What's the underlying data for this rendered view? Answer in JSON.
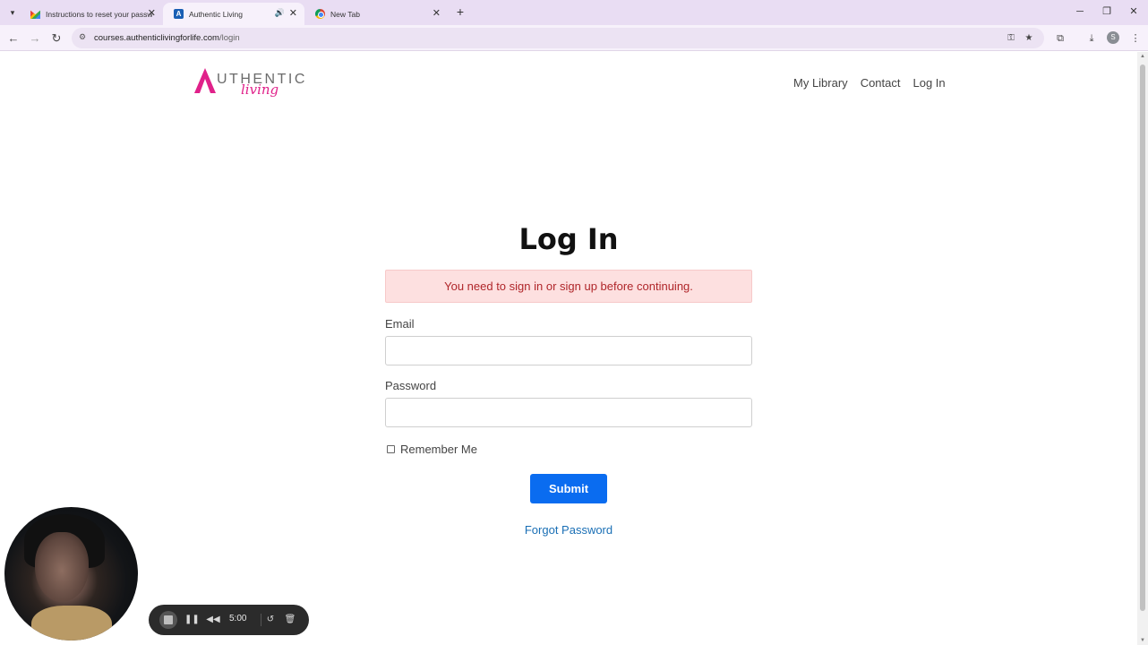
{
  "browser": {
    "tabs": [
      {
        "title": "Instructions to reset your passw",
        "icon": "gmail-icon"
      },
      {
        "title": "Authentic Living",
        "icon": "authentic-living-icon",
        "active": true
      },
      {
        "title": "New Tab",
        "icon": "chrome-icon"
      }
    ],
    "url_host": "courses.authenticlivingforlife.com",
    "url_path": "/login",
    "profile_initial": "S"
  },
  "site": {
    "logo_word": "UTHENTIC",
    "logo_script": "living",
    "nav": [
      "My Library",
      "Contact",
      "Log In"
    ]
  },
  "login": {
    "title": "Log In",
    "alert": "You need to sign in or sign up before continuing.",
    "email_label": "Email",
    "email_value": "",
    "password_label": "Password",
    "password_value": "",
    "remember_label": "Remember Me",
    "submit_label": "Submit",
    "forgot_label": "Forgot Password"
  },
  "recorder": {
    "time": "5:00"
  },
  "colors": {
    "accent": "#0a6cf0",
    "brand_pink": "#e0218a",
    "alert_bg": "#fde0e0",
    "alert_text": "#b0262a",
    "link": "#1a6fb5"
  }
}
